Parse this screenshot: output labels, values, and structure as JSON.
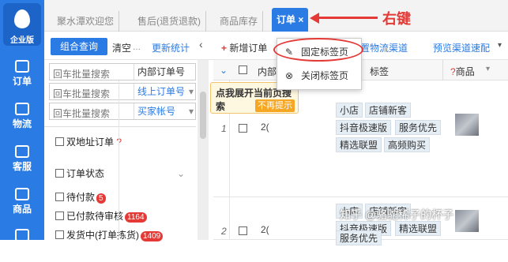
{
  "app": {
    "logo_label": "企业版"
  },
  "nav": [
    {
      "label": "订单",
      "icon": "order-icon"
    },
    {
      "label": "物流",
      "icon": "logistics-icon"
    },
    {
      "label": "客服",
      "icon": "service-icon"
    },
    {
      "label": "商品",
      "icon": "product-icon"
    }
  ],
  "tabs": [
    {
      "label": "聚水潭欢迎您"
    },
    {
      "label": "售后(退货退款)"
    },
    {
      "label": "商品库存"
    },
    {
      "label": "订单"
    }
  ],
  "tab_close": "×",
  "annotation": "右键",
  "left_panel": {
    "combo_query": "组合查询",
    "clear": "清空",
    "more": "...",
    "stats": "更新统计",
    "collapse": "‹",
    "search_rows": [
      {
        "placeholder": "回车批量搜索",
        "select": "内部订单号"
      },
      {
        "placeholder": "回车批量搜索",
        "select": "线上订单号"
      },
      {
        "placeholder": "回车批量搜索",
        "select": "买家帐号"
      }
    ],
    "filters": {
      "double_address": "双地址订单",
      "qmark": "?",
      "status_title": "订单状态",
      "items": [
        {
          "label": "待付款",
          "badge": "5"
        },
        {
          "label": "已付款待审核",
          "badge": "1164"
        },
        {
          "label": "发货中(打单拣货)",
          "badge": "1409"
        }
      ]
    }
  },
  "main_toolbar": {
    "new_order": "新增订单",
    "logistics": "设置物流渠道",
    "presale": "预览渠道速配",
    "dropdown": "▾"
  },
  "table": {
    "col_internal": "内部",
    "col_tags": "标签",
    "col_product": "商品",
    "qmark": "?",
    "rows": [
      {
        "index": "1",
        "order_no": "2(",
        "tags": [
          "小店",
          "店铺新客",
          "抖音极速版",
          "服务优先",
          "精选联盟",
          "高频购买"
        ]
      },
      {
        "index": "2",
        "order_no": "2(",
        "tags": [
          "小店",
          "店铺新客",
          "抖音极速版",
          "精选联盟",
          "服务优先"
        ]
      }
    ]
  },
  "tooltip": {
    "text": "点我展开当前页搜索",
    "button": "不再提示"
  },
  "context_menu": [
    {
      "label": "固定标签页",
      "icon": "pin-icon"
    },
    {
      "label": "关闭标签页",
      "icon": "close-circle-icon"
    }
  ],
  "watermark": "知乎 @骆驼稀子的杯子"
}
